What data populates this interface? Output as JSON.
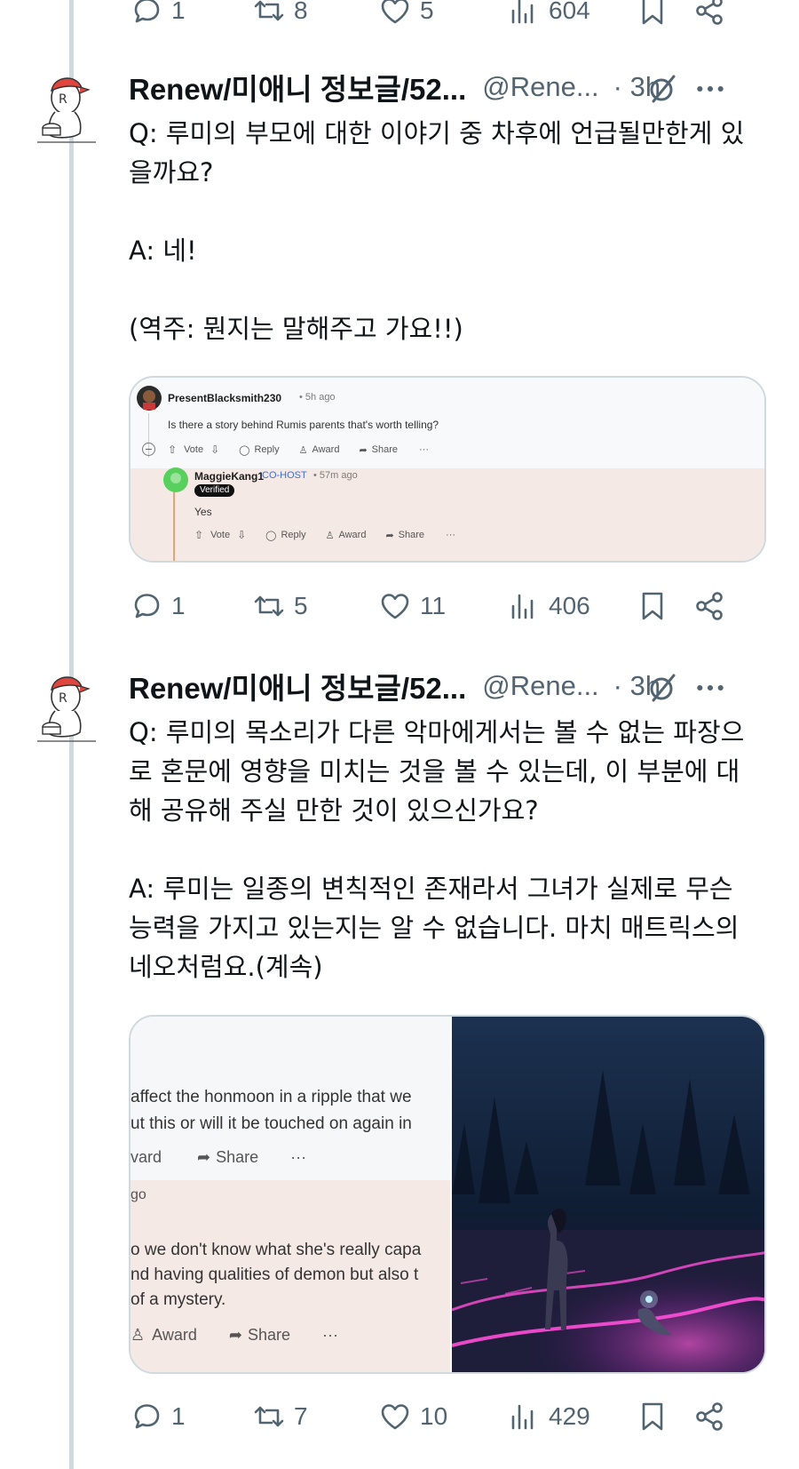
{
  "top_actions": {
    "replies": "1",
    "reposts": "8",
    "likes": "5",
    "views": "604"
  },
  "tweets": [
    {
      "name": "Renew/미애니 정보글/52...",
      "handle": "@Rene...",
      "time": "· 3h",
      "text": "Q: 루미의 부모에 대한 이야기 중 차후에 언급될만한게 있\n을까요?\n\nA: 네!\n\n(역주: 뭔지는 말해주고 가요!!)",
      "card": {
        "post_user": "PresentBlacksmith230",
        "post_time": "• 5h ago",
        "post_text": "Is there a story behind Rumis parents that's worth telling?",
        "vote": "Vote",
        "reply": "Reply",
        "award": "Award",
        "share": "Share",
        "more": "···",
        "reply_user": "MaggieKang1",
        "reply_role": "CO-HOST",
        "reply_time": "• 57m ago",
        "verified": "Verified",
        "reply_text": "Yes"
      },
      "actions": {
        "replies": "1",
        "reposts": "5",
        "likes": "11",
        "views": "406"
      }
    },
    {
      "name": "Renew/미애니 정보글/52...",
      "handle": "@Rene...",
      "time": "· 3h",
      "text": "Q: 루미의 목소리가 다른 악마에게서는 볼 수 없는 파장으\n로 혼문에 영향을 미치는 것을 볼 수 있는데, 이 부분에 대\n해 공유해 주실 만한 것이 있으신가요?\n\nA: 루미는 일종의 변칙적인 존재라서 그녀가 실제로 무슨\n능력을 가지고 있는지는 알 수 없습니다. 마치 매트릭스의\n네오처럼요.(계속)",
      "card": {
        "line1": "affect the honmoon in a ripple that we",
        "line2": "ut this or will it be touched on again in",
        "award_top": "vard",
        "share": "Share",
        "more": "···",
        "ago": "go",
        "line3": "o we don't know what she's really capa",
        "line4": "nd having qualities of demon but also t",
        "line5": "of a mystery.",
        "award": "Award"
      },
      "actions": {
        "replies": "1",
        "reposts": "7",
        "likes": "10",
        "views": "429"
      }
    }
  ],
  "icons": {
    "reply": "reply-bubble-icon",
    "repost": "repost-icon",
    "like": "heart-icon",
    "views": "views-bars-icon",
    "bookmark": "bookmark-icon",
    "share": "share-icon",
    "grok": "grok-slash-icon",
    "more": "more-dots-icon"
  },
  "colors": {
    "accent_text": "#0f1419",
    "muted": "#536471",
    "border": "#cfd9de",
    "reddit_highlight": "#f5e9e6",
    "cohost_blue": "#3c6ed6",
    "neon_pink": "#ff4fd8"
  }
}
